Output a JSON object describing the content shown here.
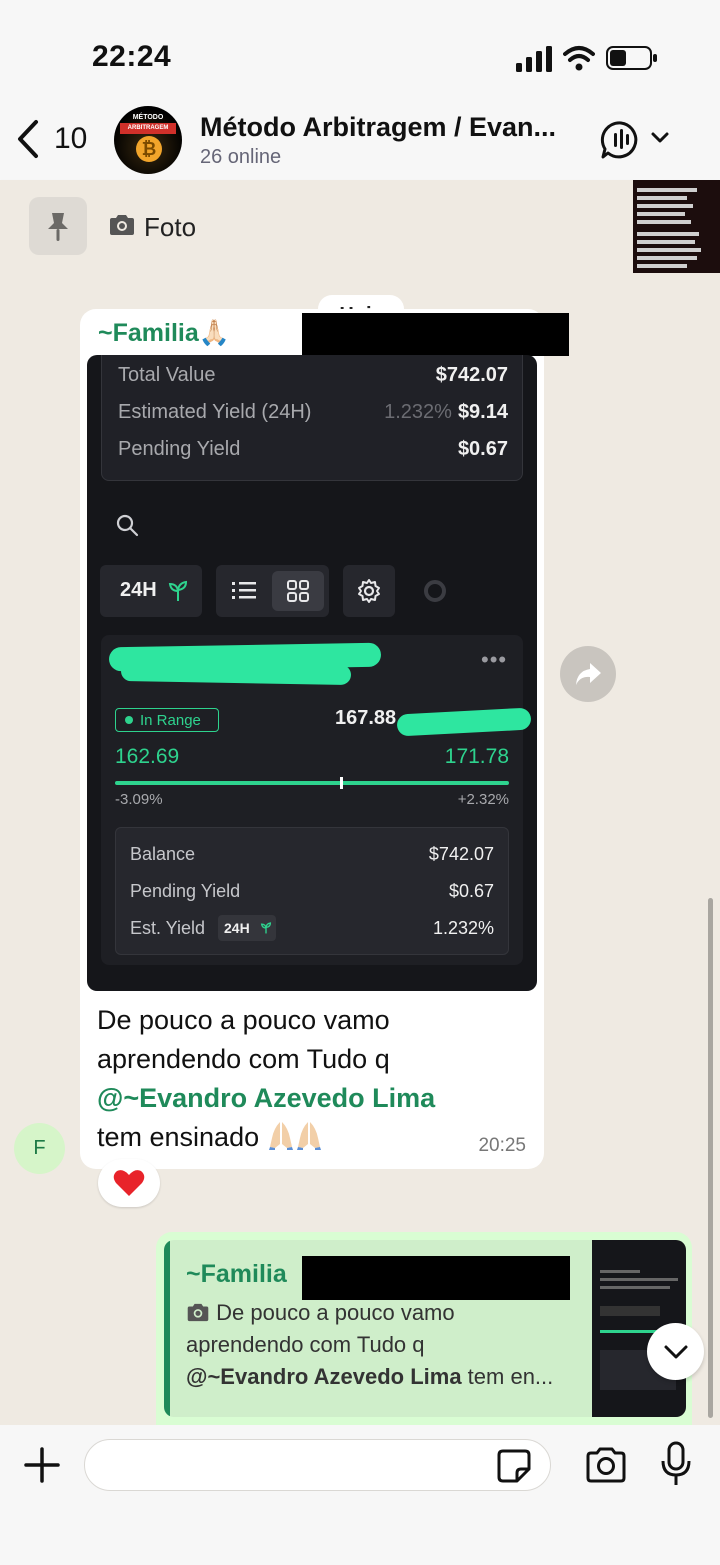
{
  "status_bar": {
    "time": "22:24"
  },
  "header": {
    "back_count": "10",
    "avatar": {
      "line1": "MÉTODO",
      "line2": "ARBITRAGEM",
      "coin": "₿"
    },
    "title": "Método Arbitragem / Evan...",
    "subtitle": "26 online"
  },
  "pinned": {
    "label": "Foto"
  },
  "chat": {
    "date_chip": "Hoje",
    "incoming": {
      "sender": "~Familia🙏🏻",
      "screenshot": {
        "summary": {
          "total_value_label": "Total Value",
          "total_value": "$742.07",
          "est_yield_label": "Estimated Yield (24H)",
          "est_yield_pct": "1.232%",
          "est_yield_value": "$9.14",
          "pending_label": "Pending Yield",
          "pending_value": "$0.67"
        },
        "timeframe": "24H",
        "position": {
          "status": "In Range",
          "current_price": "167.88",
          "range_low": "162.69",
          "range_high": "171.78",
          "low_pct": "-3.09%",
          "high_pct": "+2.32%",
          "current_fraction": 0.57,
          "balance_label": "Balance",
          "balance_value": "$742.07",
          "pending_label": "Pending Yield",
          "pending_value": "$0.67",
          "est_yield_label": "Est. Yield",
          "est_yield_chip": "24H",
          "est_yield_value": "1.232%"
        }
      },
      "text_line1": "De pouco a pouco vamo",
      "text_line2": "aprendendo  com Tudo q",
      "mention": "@~Evandro Azevedo Lima",
      "text_line4": "tem ensinado",
      "time": "20:25",
      "sender_avatar": "F",
      "reaction": "heart"
    },
    "outgoing_quote": {
      "sender": "~Familia",
      "line1": "De pouco a pouco vamo",
      "line2": "aprendendo  com Tudo q",
      "mention": "@~Evandro Azevedo Lima",
      "line3_rest": " tem en..."
    }
  },
  "colors": {
    "accent_green": "#1f8a5a",
    "range_green": "#2ed38e",
    "outgoing_bubble": "#d9fdd3"
  }
}
